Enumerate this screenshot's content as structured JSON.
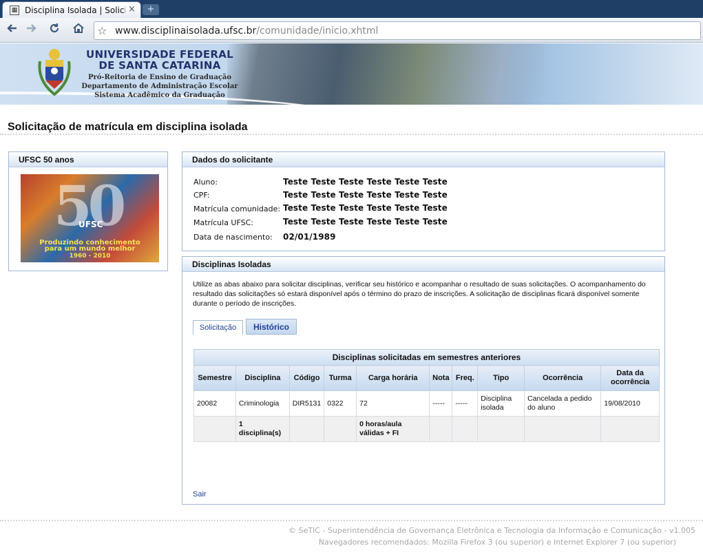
{
  "browser": {
    "tab_title": "Disciplina Isolada | Solicit...",
    "tab_close": "×",
    "new_tab": "+",
    "url_host": "www.disciplinaisolada.ufsc.br",
    "url_path": "/comunidade/inicio.xhtml",
    "icons": {
      "back": "back-arrow-icon",
      "forward": "forward-arrow-icon",
      "reload": "reload-icon",
      "home": "home-icon",
      "bookmark": "star-icon"
    }
  },
  "banner": {
    "line1": "UNIVERSIDADE FEDERAL",
    "line2": "DE SANTA CATARINA",
    "line3": "Pró-Reitoria de Ensino de Graduação",
    "line4": "Departamento de Administração Escolar",
    "line5": "Sistema Acadêmico da Graduação"
  },
  "page": {
    "title": "Solicitação de matrícula em disciplina isolada"
  },
  "sidebar": {
    "header": "UFSC 50 anos",
    "logo": {
      "number": "50",
      "brand": "UFSC",
      "tagline1": "Produzindo conhecimento",
      "tagline2": "para um mundo melhor",
      "years": "1960 - 2010"
    }
  },
  "requester": {
    "header": "Dados do solicitante",
    "rows": [
      {
        "label": "Aluno:",
        "value": "Teste Teste Teste Teste Teste Teste"
      },
      {
        "label": "CPF:",
        "value": "Teste Teste Teste Teste Teste Teste"
      },
      {
        "label": "Matrícula comunidade:",
        "value": "Teste Teste Teste Teste Teste Teste"
      },
      {
        "label": "Matrícula UFSC:",
        "value": "Teste Teste Teste Teste Teste Teste"
      },
      {
        "label": "Data de nascimento:",
        "value": "02/01/1989"
      }
    ]
  },
  "courses": {
    "header": "Disciplinas Isoladas",
    "intro": "Utilize as abas abaixo para solicitar disciplinas, verificar seu histórico e acompanhar o resultado de suas solicitações. O acompanhamento do resultado das solicitações só estará disponível após o término do prazo de inscrições. A solicitação de disciplinas ficará disponível somente durante o período de inscrições.",
    "tabs": [
      {
        "label": "Solicitação",
        "active": false
      },
      {
        "label": "Histórico",
        "active": true
      }
    ],
    "table": {
      "caption": "Disciplinas solicitadas em semestres anteriores",
      "columns": [
        "Semestre",
        "Disciplina",
        "Código",
        "Turma",
        "Carga horária",
        "Nota",
        "Freq.",
        "Tipo",
        "Ocorrência",
        "Data da ocorrência"
      ],
      "rows": [
        [
          "20082",
          "Criminologia",
          "DIR5131",
          "0322",
          "72",
          "-----",
          "-----",
          "Disciplina isolada",
          "Cancelada a pedido do aluno",
          "19/08/2010"
        ]
      ],
      "total_row": [
        "",
        "1 disciplina(s)",
        "",
        "",
        "0 horas/aula válidas + FI",
        "",
        "",
        "",
        "",
        ""
      ]
    },
    "exit_link": "Sair"
  },
  "footer": {
    "line1": "© SeTIC - Superintendência de Governança Eletrônica e Tecnologia da Informação e Comunicação - v1.005",
    "line2": "Navegadores recomendados: Mozilla Firefox 3 (ou superior) e Internet Explorer 7 (ou superior)"
  }
}
